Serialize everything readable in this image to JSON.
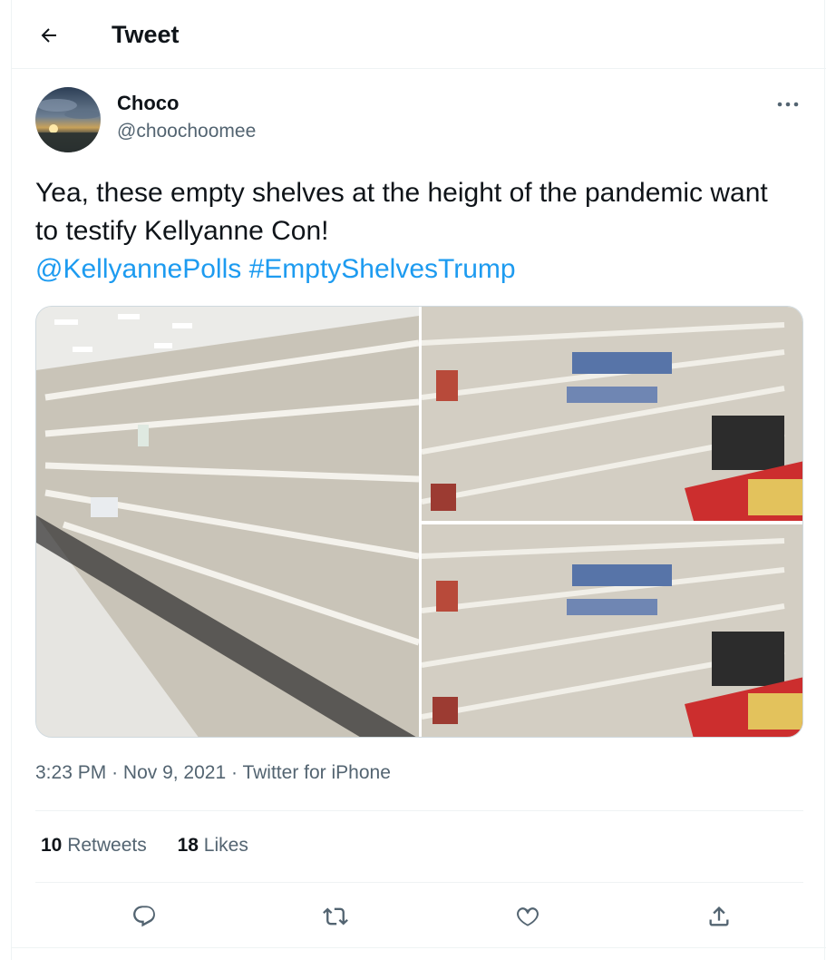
{
  "header": {
    "back_icon": "arrow-left-icon",
    "title": "Tweet"
  },
  "author": {
    "name": "Choco",
    "handle": "@choochoomee",
    "avatar_icon": "profile-avatar"
  },
  "tweet": {
    "text": "Yea, these empty shelves at the height of the pandemic want to testify Kellyanne Con!",
    "mention": "@KellyannePolls",
    "hashtag": "#EmptyShelvesTrump",
    "time": "3:23 PM",
    "date": "Nov 9, 2021",
    "source": "Twitter for iPhone",
    "separator": "·"
  },
  "stats": {
    "retweets_count": "10",
    "retweets_label": "Retweets",
    "likes_count": "18",
    "likes_label": "Likes"
  },
  "actions": [
    "reply-icon",
    "retweet-icon",
    "like-icon",
    "share-icon"
  ],
  "colors": {
    "link": "#1d9bf0",
    "secondary_text": "#536471",
    "border": "#eff3f4",
    "primary_text": "#0f1419"
  }
}
